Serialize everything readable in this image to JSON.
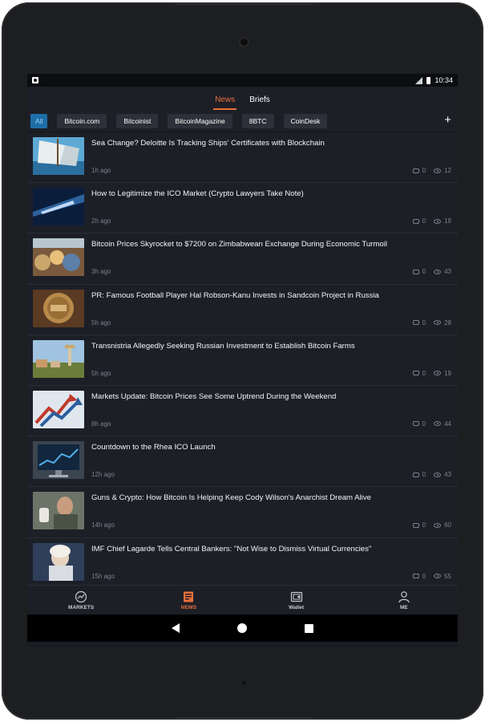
{
  "statusbar": {
    "time": "10:34"
  },
  "topnav": {
    "tabs": [
      {
        "label": "News",
        "active": true
      },
      {
        "label": "Briefs",
        "active": false
      }
    ]
  },
  "sources": {
    "chips": [
      {
        "label": "All",
        "active": true
      },
      {
        "label": "Bitcoin.com",
        "active": false
      },
      {
        "label": "Bitcoinist",
        "active": false
      },
      {
        "label": "BitcoinMagazine",
        "active": false
      },
      {
        "label": "8BTC",
        "active": false
      },
      {
        "label": "CoinDesk",
        "active": false
      }
    ],
    "add_label": "+"
  },
  "feed": {
    "items": [
      {
        "title": "Sea Change? Deloitte Is Tracking Ships' Certificates with Blockchain",
        "time": "1h ago",
        "comments": "0",
        "views": "12"
      },
      {
        "title": "How to Legitimize the ICO Market (Crypto Lawyers Take Note)",
        "time": "2h ago",
        "comments": "0",
        "views": "19"
      },
      {
        "title": "Bitcoin Prices Skyrocket to $7200 on Zimbabwean Exchange During Economic Turmoil",
        "time": "3h ago",
        "comments": "0",
        "views": "43"
      },
      {
        "title": "PR: Famous Football Player Hal Robson-Kanu Invests in Sandcoin Project in Russia",
        "time": "5h ago",
        "comments": "0",
        "views": "28"
      },
      {
        "title": "Transnistria Allegedly Seeking Russian Investment to Establish Bitcoin Farms",
        "time": "5h ago",
        "comments": "0",
        "views": "19"
      },
      {
        "title": "Markets Update: Bitcoin Prices See Some Uptrend During the Weekend",
        "time": "8h ago",
        "comments": "0",
        "views": "44"
      },
      {
        "title": "Countdown to the Rhea ICO Launch",
        "time": "12h ago",
        "comments": "0",
        "views": "43"
      },
      {
        "title": "Guns & Crypto: How Bitcoin Is Helping Keep Cody Wilson's Anarchist Dream Alive",
        "time": "14h ago",
        "comments": "0",
        "views": "60"
      },
      {
        "title": "IMF Chief Lagarde Tells Central Bankers: \"Not Wise to Dismiss Virtual Currencies\"",
        "time": "15h ago",
        "comments": "0",
        "views": "55"
      }
    ]
  },
  "bottomnav": {
    "items": [
      {
        "label": "MARKETS",
        "icon": "markets-icon",
        "active": false
      },
      {
        "label": "NEWS",
        "icon": "news-icon",
        "active": true
      },
      {
        "label": "Wallet",
        "icon": "wallet-icon",
        "active": false
      },
      {
        "label": "ME",
        "icon": "profile-icon",
        "active": false
      }
    ]
  },
  "colors": {
    "accent": "#e8703a",
    "chip_active": "#1e6fa8",
    "background": "#1d1f27"
  }
}
